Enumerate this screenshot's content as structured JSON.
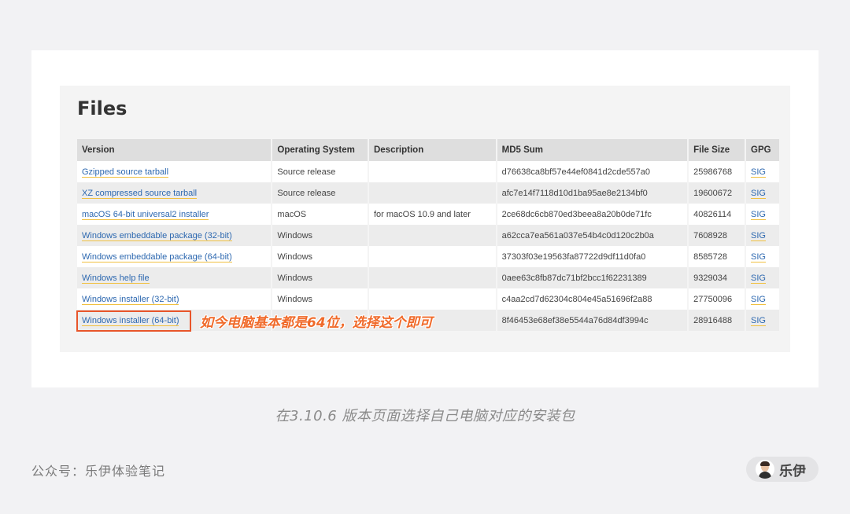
{
  "files_section": {
    "title": "Files",
    "columns": [
      "Version",
      "Operating System",
      "Description",
      "MD5 Sum",
      "File Size",
      "GPG"
    ],
    "rows": [
      {
        "version": "Gzipped source tarball",
        "os": "Source release",
        "description": "",
        "md5": "d76638ca8bf57e44ef0841d2cde557a0",
        "size": "25986768",
        "gpg": "SIG"
      },
      {
        "version": "XZ compressed source tarball",
        "os": "Source release",
        "description": "",
        "md5": "afc7e14f7118d10d1ba95ae8e2134bf0",
        "size": "19600672",
        "gpg": "SIG"
      },
      {
        "version": "macOS 64-bit universal2 installer",
        "os": "macOS",
        "description": "for macOS 10.9 and later",
        "md5": "2ce68dc6cb870ed3beea8a20b0de71fc",
        "size": "40826114",
        "gpg": "SIG"
      },
      {
        "version": "Windows embeddable package (32-bit)",
        "os": "Windows",
        "description": "",
        "md5": "a62cca7ea561a037e54b4c0d120c2b0a",
        "size": "7608928",
        "gpg": "SIG"
      },
      {
        "version": "Windows embeddable package (64-bit)",
        "os": "Windows",
        "description": "",
        "md5": "37303f03e19563fa87722d9df11d0fa0",
        "size": "8585728",
        "gpg": "SIG"
      },
      {
        "version": "Windows help file",
        "os": "Windows",
        "description": "",
        "md5": "0aee63c8fb87dc71bf2bcc1f62231389",
        "size": "9329034",
        "gpg": "SIG"
      },
      {
        "version": "Windows installer (32-bit)",
        "os": "Windows",
        "description": "",
        "md5": "c4aa2cd7d62304c804e45a51696f2a88",
        "size": "27750096",
        "gpg": "SIG"
      },
      {
        "version": "Windows installer (64-bit)",
        "os": "",
        "description": "",
        "md5": "8f46453e68ef38e5544a76d84df3994c",
        "size": "28916488",
        "gpg": "SIG"
      }
    ]
  },
  "annotation": "如今电脑基本都是64位，选择这个即可",
  "caption": "在3.10.6 版本页面选择自己电脑对应的安装包",
  "footer": {
    "account": "公众号：乐伊体验笔记",
    "author": "乐伊"
  },
  "colors": {
    "link": "#2d68b0",
    "link_underline": "#f0c040",
    "highlight": "#e8552a",
    "annotation": "#f06a2a"
  }
}
